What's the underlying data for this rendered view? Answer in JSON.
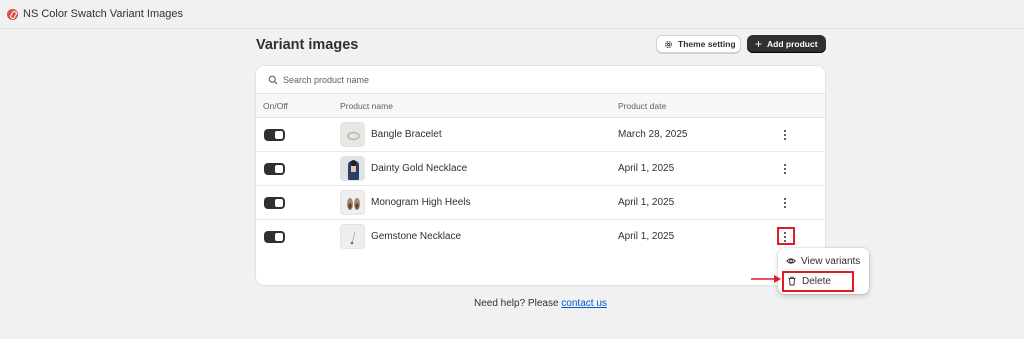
{
  "app": {
    "title": "NS Color Swatch Variant Images",
    "logo_color": "#d4523f"
  },
  "page": {
    "title": "Variant images"
  },
  "actions": {
    "theme_setting": "Theme setting",
    "add_product": "Add product",
    "add_icon": "+"
  },
  "search": {
    "placeholder": "Search product name",
    "value": ""
  },
  "table": {
    "headers": {
      "onoff": "On/Off",
      "name": "Product name",
      "date": "Product date"
    },
    "rows": [
      {
        "enabled": true,
        "name": "Bangle Bracelet",
        "date": "March 28, 2025",
        "thumb_icon": "bracelet-thumbnail"
      },
      {
        "enabled": true,
        "name": "Dainty Gold Necklace",
        "date": "April 1, 2025",
        "thumb_icon": "necklace-model-thumbnail"
      },
      {
        "enabled": true,
        "name": "Monogram High Heels",
        "date": "April 1, 2025",
        "thumb_icon": "heels-thumbnail"
      },
      {
        "enabled": true,
        "name": "Gemstone Necklace",
        "date": "April 1, 2025",
        "thumb_icon": "gemstone-thumbnail"
      }
    ]
  },
  "menu": {
    "view_variants": "View variants",
    "delete": "Delete"
  },
  "annotation_color": "#e01b24",
  "footer": {
    "help_text": "Need help? Please ",
    "link_text": "contact us"
  }
}
